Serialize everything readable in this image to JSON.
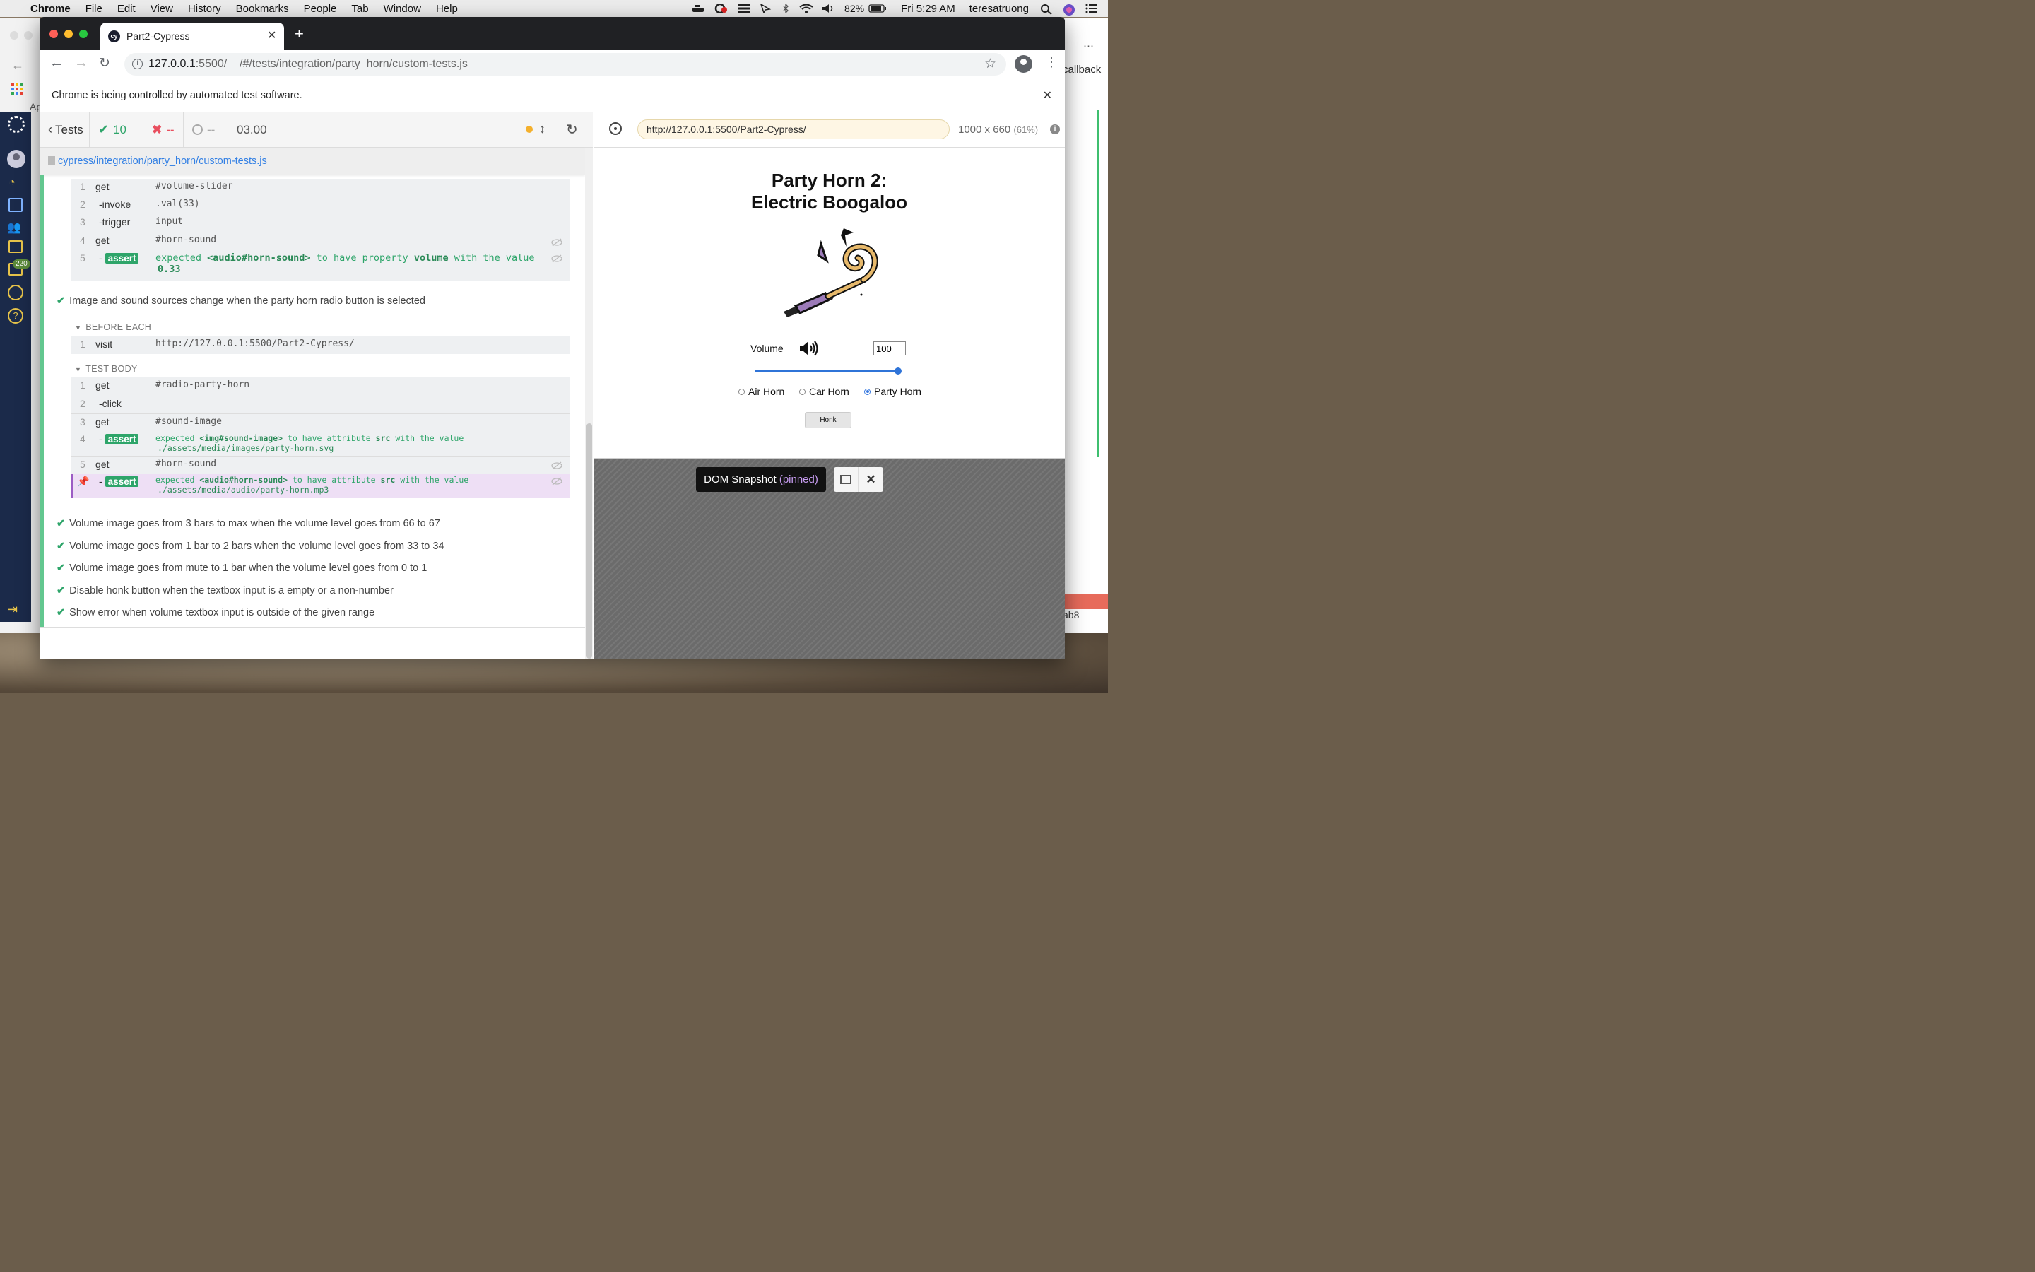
{
  "menubar": {
    "app": "Chrome",
    "items": [
      "File",
      "Edit",
      "View",
      "History",
      "Bookmarks",
      "People",
      "Tab",
      "Window",
      "Help"
    ],
    "battery": "82%",
    "clock": "Fri 5:29 AM",
    "user": "teresatruong"
  },
  "background_window": {
    "right_text": "callback",
    "right_text2": "ab8",
    "left_text": "Ap"
  },
  "cypress_sidebar": {
    "badge": "220"
  },
  "browser": {
    "tab_title": "Part2-Cypress",
    "url_host": "127.0.0.1",
    "url_rest": ":5500/__/#/tests/integration/party_horn/custom-tests.js",
    "infobar_text": "Chrome is being controlled by automated test software."
  },
  "reporter": {
    "tests_label": "Tests",
    "passed": "10",
    "failed": "--",
    "pending": "--",
    "duration": "03.00",
    "file_path": "cypress/integration/party_horn/custom-tests.js",
    "block1": [
      {
        "num": "1",
        "name": "get",
        "msg": "#volume-slider"
      },
      {
        "num": "2",
        "name": "-invoke",
        "msg": ".val(33)"
      },
      {
        "num": "3",
        "name": "-trigger",
        "msg": "input"
      },
      {
        "num": "4",
        "name": "get",
        "msg": "#horn-sound"
      },
      {
        "num": "5",
        "name": "assert",
        "parts": [
          "expected",
          "<audio#horn-sound>",
          "to have property",
          "volume",
          "with the value"
        ],
        "value": "0.33"
      }
    ],
    "test_title": "Image and sound sources change when the party horn radio button is selected",
    "before_each_label": "BEFORE EACH",
    "before_each_cmd": {
      "num": "1",
      "name": "visit",
      "msg": "http://127.0.0.1:5500/Part2-Cypress/"
    },
    "test_body_label": "TEST BODY",
    "body": [
      {
        "num": "1",
        "name": "get",
        "msg": "#radio-party-horn"
      },
      {
        "num": "2",
        "name": "-click",
        "msg": ""
      },
      {
        "num": "3",
        "name": "get",
        "msg": "#sound-image"
      },
      {
        "num": "4",
        "name": "assert",
        "parts": [
          "expected",
          "<img#sound-image>",
          "to have attribute",
          "src",
          "with the value"
        ],
        "value": "./assets/media/images/party-horn.svg"
      },
      {
        "num": "5",
        "name": "get",
        "msg": "#horn-sound"
      },
      {
        "num": "",
        "name": "assert",
        "parts": [
          "expected",
          "<audio#horn-sound>",
          "to have attribute",
          "src",
          "with the value"
        ],
        "value": "./assets/media/audio/party-horn.mp3"
      }
    ],
    "other_tests": [
      "Volume image goes from 3 bars to max when the volume level goes from 66 to 67",
      "Volume image goes from 1 bar to 2 bars when the volume level goes from 33 to 34",
      "Volume image goes from mute to 1 bar when the volume level goes from 0 to 1",
      "Disable honk button when the textbox input is a empty or a non-number",
      "Show error when volume textbox input is outside of the given range"
    ]
  },
  "aut": {
    "url": "http://127.0.0.1:5500/Part2-Cypress/",
    "viewport": "1000 x 660",
    "scale": "(61%)",
    "title_line1": "Party Horn 2:",
    "title_line2": "Electric Boogaloo",
    "volume_label": "Volume",
    "volume_value": "100",
    "volume_level": 1.0,
    "radios": [
      {
        "label": "Air Horn",
        "checked": false
      },
      {
        "label": "Car Horn",
        "checked": false
      },
      {
        "label": "Party Horn",
        "checked": true
      }
    ],
    "honk_label": "Honk"
  },
  "snapshot": {
    "label": "DOM Snapshot",
    "state": "(pinned)"
  }
}
